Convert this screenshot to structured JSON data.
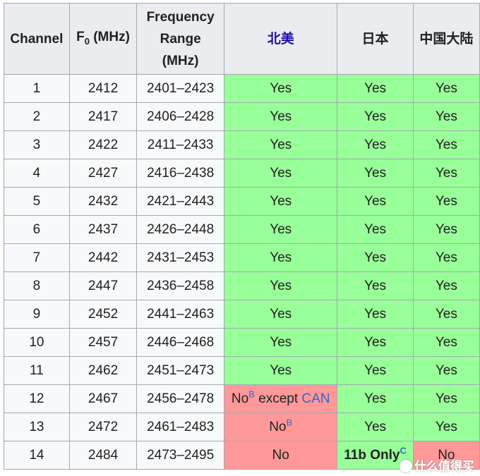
{
  "headers": {
    "channel": "Channel",
    "f0_main": "F",
    "f0_sub": "0",
    "f0_unit": " (MHz)",
    "range": "Frequency Range (MHz)",
    "north_america": "北美",
    "japan": "日本",
    "china": "中国大陆"
  },
  "colors": {
    "yes": "#99ff99",
    "no": "#ff9999",
    "header": "#eaecf0",
    "link": "#3366cc"
  },
  "rows": [
    {
      "ch": "1",
      "f0": "2412",
      "range": "2401–2423",
      "na": "Yes",
      "jp": "Yes",
      "cn": "Yes"
    },
    {
      "ch": "2",
      "f0": "2417",
      "range": "2406–2428",
      "na": "Yes",
      "jp": "Yes",
      "cn": "Yes"
    },
    {
      "ch": "3",
      "f0": "2422",
      "range": "2411–2433",
      "na": "Yes",
      "jp": "Yes",
      "cn": "Yes"
    },
    {
      "ch": "4",
      "f0": "2427",
      "range": "2416–2438",
      "na": "Yes",
      "jp": "Yes",
      "cn": "Yes"
    },
    {
      "ch": "5",
      "f0": "2432",
      "range": "2421–2443",
      "na": "Yes",
      "jp": "Yes",
      "cn": "Yes"
    },
    {
      "ch": "6",
      "f0": "2437",
      "range": "2426–2448",
      "na": "Yes",
      "jp": "Yes",
      "cn": "Yes"
    },
    {
      "ch": "7",
      "f0": "2442",
      "range": "2431–2453",
      "na": "Yes",
      "jp": "Yes",
      "cn": "Yes"
    },
    {
      "ch": "8",
      "f0": "2447",
      "range": "2436–2458",
      "na": "Yes",
      "jp": "Yes",
      "cn": "Yes"
    },
    {
      "ch": "9",
      "f0": "2452",
      "range": "2441–2463",
      "na": "Yes",
      "jp": "Yes",
      "cn": "Yes"
    },
    {
      "ch": "10",
      "f0": "2457",
      "range": "2446–2468",
      "na": "Yes",
      "jp": "Yes",
      "cn": "Yes"
    },
    {
      "ch": "11",
      "f0": "2462",
      "range": "2451–2473",
      "na": "Yes",
      "jp": "Yes",
      "cn": "Yes"
    },
    {
      "ch": "12",
      "f0": "2467",
      "range": "2456–2478",
      "na": "No",
      "na_sup": "B",
      "na_extra": " except ",
      "na_link": "CAN",
      "jp": "Yes",
      "cn": "Yes"
    },
    {
      "ch": "13",
      "f0": "2472",
      "range": "2461–2483",
      "na": "No",
      "na_sup": "B",
      "jp": "Yes",
      "cn": "Yes"
    },
    {
      "ch": "14",
      "f0": "2484",
      "range": "2473–2495",
      "na": "No",
      "jp": "11b Only",
      "jp_sup": "C",
      "cn": "No"
    }
  ],
  "watermark": "什么值得买"
}
